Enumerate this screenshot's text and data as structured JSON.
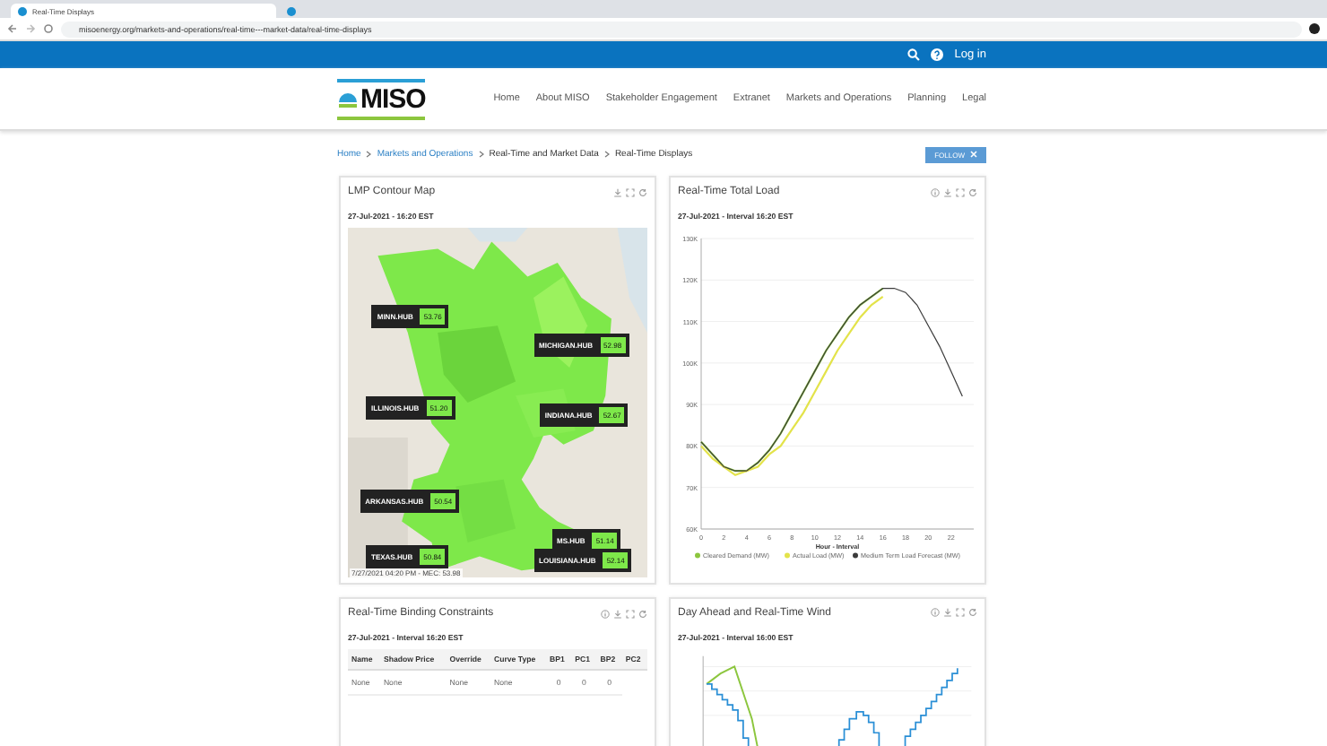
{
  "browser": {
    "tabs": [
      {
        "title": "Real-Time Displays",
        "selected": true
      },
      {
        "selected": false
      }
    ],
    "url": "misoenergy.org/markets-and-operations/real-time---market-data/real-time-displays"
  },
  "topbar": {
    "login": "Log in"
  },
  "logo": "MISO",
  "nav": [
    "Home",
    "About MISO",
    "Stakeholder Engagement",
    "Extranet",
    "Markets and Operations",
    "Planning",
    "Legal"
  ],
  "breadcrumb": [
    {
      "label": "Home",
      "link": true
    },
    {
      "label": "Markets and Operations",
      "link": true
    },
    {
      "label": "Real-Time and Market Data",
      "link": false
    },
    {
      "label": "Real-Time Displays",
      "link": false
    }
  ],
  "follow": "FOLLOW",
  "map_panel": {
    "title": "LMP Contour Map",
    "subtitle": "27-Jul-2021 - 16:20 EST",
    "hubs": [
      {
        "name": "MINN.HUB",
        "price": "53.76"
      },
      {
        "name": "MICHIGAN.HUB",
        "price": "52.98"
      },
      {
        "name": "ILLINOIS.HUB",
        "price": "51.20"
      },
      {
        "name": "INDIANA.HUB",
        "price": "52.67"
      },
      {
        "name": "ARKANSAS.HUB",
        "price": "50.54"
      },
      {
        "name": "MS.HUB",
        "price": "51.14"
      },
      {
        "name": "TEXAS.HUB",
        "price": "50.84"
      },
      {
        "name": "LOUISIANA.HUB",
        "price": "52.14"
      }
    ],
    "footer": "7/27/2021 04:20 PM - MEC: 53.98"
  },
  "load_panel": {
    "title": "Real-Time Total Load",
    "subtitle": "27-Jul-2021 - Interval 16:20 EST",
    "chart_data": {
      "type": "line",
      "xlabel": "Hour - Interval",
      "grid": true,
      "legend": "bottom",
      "xlim": [
        0,
        24
      ],
      "x": [
        0,
        1,
        2,
        3,
        4,
        5,
        6,
        7,
        8,
        9,
        10,
        11,
        12,
        13,
        14,
        15,
        16,
        17,
        18,
        19,
        20,
        21,
        22,
        23
      ],
      "xticks": [
        0,
        2,
        4,
        6,
        8,
        10,
        12,
        14,
        16,
        18,
        20,
        22
      ],
      "ylim": [
        60,
        130
      ],
      "yticks": [
        {
          "value": 130,
          "label": "130K"
        },
        {
          "value": 120,
          "label": "120K"
        },
        {
          "value": 110,
          "label": "110K"
        },
        {
          "value": 100,
          "label": "100K"
        },
        {
          "value": 90,
          "label": "90K"
        },
        {
          "value": 80,
          "label": "80K"
        },
        {
          "value": 70,
          "label": "70K"
        },
        {
          "value": 60,
          "label": "60K"
        }
      ],
      "series": [
        {
          "name": "Cleared Demand (MW)",
          "color": "#8cc63e",
          "values": [
            81,
            78,
            75,
            74,
            74,
            76,
            79,
            83,
            88,
            93,
            98,
            103,
            107,
            111,
            114,
            116,
            118,
            null,
            null,
            null,
            null,
            null,
            null,
            null
          ]
        },
        {
          "name": "Actual Load (MW)",
          "color": "#e3e34a",
          "values": [
            80,
            77,
            75,
            73,
            74,
            75,
            78,
            80,
            84,
            88,
            93,
            98,
            103,
            107,
            111,
            114,
            116,
            null,
            null,
            null,
            null,
            null,
            null,
            null
          ]
        },
        {
          "name": "Medium Term Load Forecast (MW)",
          "color": "#3c3c3c",
          "values": [
            81,
            78,
            75,
            74,
            74,
            76,
            79,
            83,
            88,
            93,
            98,
            103,
            107,
            111,
            114,
            116,
            118,
            118,
            117,
            114,
            109,
            104,
            98,
            92
          ]
        }
      ]
    }
  },
  "constraints_panel": {
    "title": "Real-Time Binding Constraints",
    "subtitle": "27-Jul-2021 - Interval 16:20 EST",
    "columns": [
      "Name",
      "Shadow Price",
      "Override",
      "Curve Type",
      "BP1",
      "PC1",
      "BP2",
      "PC2"
    ],
    "rows": [
      [
        "None",
        "None",
        "None",
        "None",
        "0",
        "0",
        "0"
      ]
    ]
  },
  "wind_panel": {
    "title": "Day Ahead and Real-Time Wind",
    "subtitle": "27-Jul-2021 - Interval 16:00 EST"
  }
}
